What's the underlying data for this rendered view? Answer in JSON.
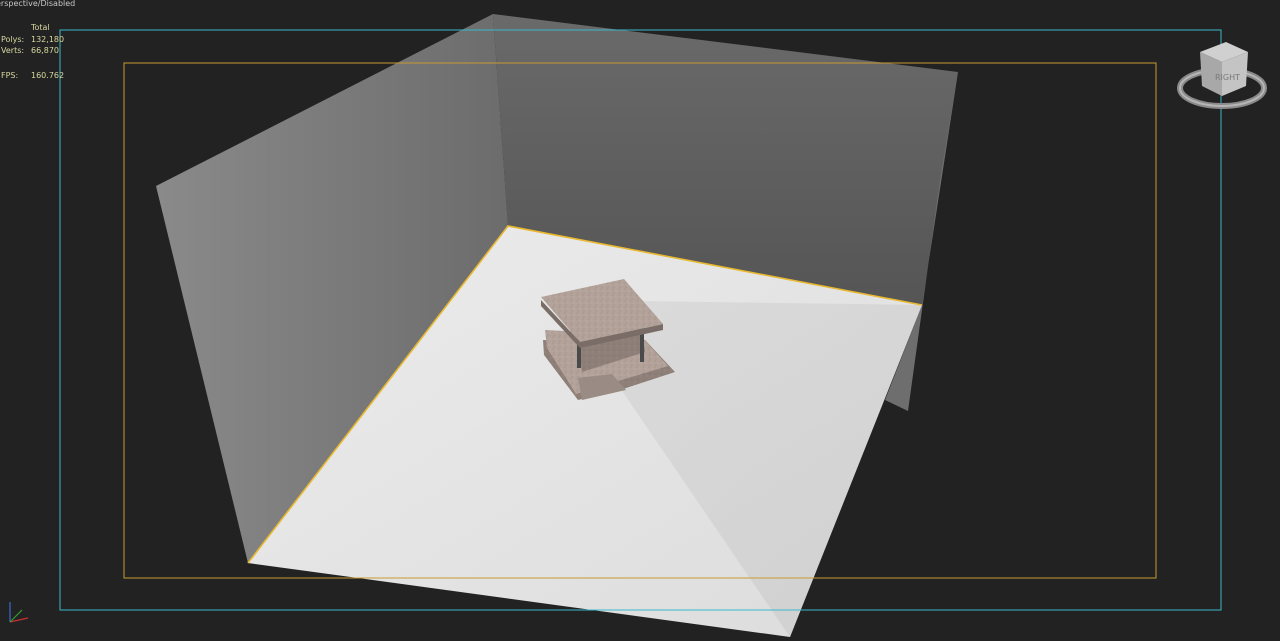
{
  "viewport": {
    "label": "erspective/Disabled",
    "stats": {
      "header": "Total",
      "polys_label": "Polys:",
      "polys_value": "132,180",
      "verts_label": "Verts:",
      "verts_value": "66,870",
      "fps_label": "FPS:",
      "fps_value": "160.762"
    },
    "viewcube_face": "RIGHT",
    "colors": {
      "background": "#222222",
      "safe_frame_outer": "#3ab8c8",
      "safe_frame_inner": "#c89a30",
      "selection_edge": "#e8b830",
      "wall_back": "#5e5e5e",
      "wall_left": "#7a7a7a",
      "floor": "#e2e2e2"
    },
    "icons": [
      "viewcube-icon",
      "axis-tripod-icon"
    ]
  }
}
